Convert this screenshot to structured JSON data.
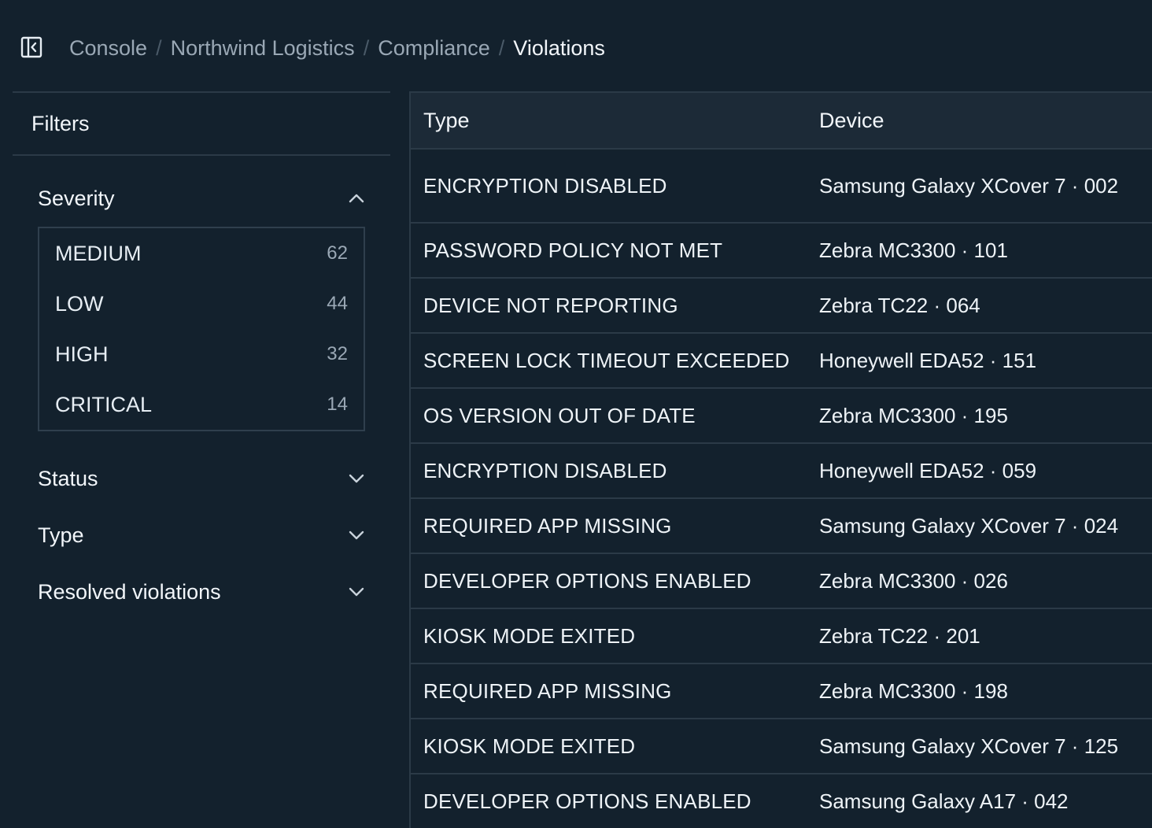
{
  "header": {
    "breadcrumb": [
      "Console",
      "Northwind Logistics",
      "Compliance",
      "Violations"
    ],
    "separator": "/"
  },
  "sidebar": {
    "title": "Filters",
    "severity": {
      "label": "Severity",
      "expanded": true,
      "options": [
        {
          "label": "MEDIUM",
          "count": "62"
        },
        {
          "label": "LOW",
          "count": "44"
        },
        {
          "label": "HIGH",
          "count": "32"
        },
        {
          "label": "CRITICAL",
          "count": "14"
        }
      ]
    },
    "facets": [
      {
        "label": "Status",
        "expanded": false
      },
      {
        "label": "Type",
        "expanded": false
      },
      {
        "label": "Resolved violations",
        "expanded": false
      }
    ]
  },
  "table": {
    "columns": [
      "Type",
      "Device"
    ],
    "rows": [
      {
        "type": "ENCRYPTION DISABLED",
        "device": "Samsung Galaxy XCover 7 · 002"
      },
      {
        "type": "PASSWORD POLICY NOT MET",
        "device": "Zebra MC3300 · 101"
      },
      {
        "type": "DEVICE NOT REPORTING",
        "device": "Zebra TC22 · 064"
      },
      {
        "type": "SCREEN LOCK TIMEOUT EXCEEDED",
        "device": "Honeywell EDA52 · 151"
      },
      {
        "type": "OS VERSION OUT OF DATE",
        "device": "Zebra MC3300 · 195"
      },
      {
        "type": "ENCRYPTION DISABLED",
        "device": "Honeywell EDA52 · 059"
      },
      {
        "type": "REQUIRED APP MISSING",
        "device": "Samsung Galaxy XCover 7 · 024"
      },
      {
        "type": "DEVELOPER OPTIONS ENABLED",
        "device": "Zebra MC3300 · 026"
      },
      {
        "type": "KIOSK MODE EXITED",
        "device": "Zebra TC22 · 201"
      },
      {
        "type": "REQUIRED APP MISSING",
        "device": "Zebra MC3300 · 198"
      },
      {
        "type": "KIOSK MODE EXITED",
        "device": "Samsung Galaxy XCover 7 · 125"
      },
      {
        "type": "DEVELOPER OPTIONS ENABLED",
        "device": "Samsung Galaxy A17 · 042"
      }
    ]
  },
  "icons": {
    "sidebar_toggle": "sidebar-collapse-icon",
    "expanded": "chevron-up-icon",
    "collapsed": "chevron-down-icon"
  },
  "colors": {
    "background": "#13212d",
    "header_row": "#1c2a37",
    "border": "#2b3a47",
    "muted_text": "#9aa8b5",
    "text": "#f2f6fa"
  }
}
